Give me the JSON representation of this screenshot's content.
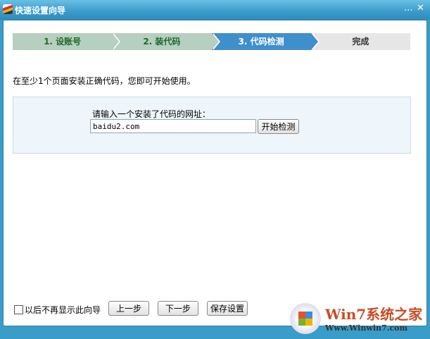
{
  "window": {
    "title": "快速设置向导",
    "minimize": "...",
    "close": "✕"
  },
  "steps": [
    {
      "label": "1. 设账号"
    },
    {
      "label": "2. 装代码"
    },
    {
      "label": "3. 代码检测"
    },
    {
      "label": "完成"
    }
  ],
  "intro": "在至少1个页面安装正确代码，您即可开始使用。",
  "panel": {
    "label": "请输入一个安装了代码的网址：",
    "url_value": "baidu2.com",
    "check_button": "开始检测"
  },
  "footer": {
    "checkbox_label": "以后不再显示此向导",
    "checkbox_checked": false,
    "prev": "上一步",
    "next": "下一步",
    "save": "保存设置"
  },
  "watermark": {
    "title": "Win7系统之家",
    "url": "Www.Winwin7.com"
  }
}
